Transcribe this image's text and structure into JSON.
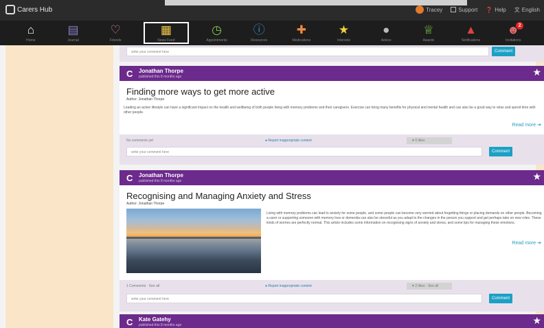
{
  "app": {
    "name": "Carers Hub"
  },
  "topbar": {
    "links": [
      {
        "label": "Tracey",
        "icon": "avatar-icon"
      },
      {
        "label": "Support",
        "icon": "monitor-icon"
      },
      {
        "label": "Help",
        "icon": "help-icon"
      },
      {
        "label": "English",
        "icon": "translate-icon"
      }
    ]
  },
  "nav": [
    {
      "label": "Home",
      "icon": "home-icon",
      "color": "#ffffff"
    },
    {
      "label": "Journal",
      "icon": "journal-icon",
      "color": "#8b7fc9"
    },
    {
      "label": "Friends",
      "icon": "handshake-icon",
      "color": "#e17b9a"
    },
    {
      "label": "News Feed",
      "icon": "newsfeed-icon",
      "color": "#f2c84b",
      "active": true
    },
    {
      "label": "Appointments",
      "icon": "clock-icon",
      "color": "#84c94b"
    },
    {
      "label": "Resources",
      "icon": "info-icon",
      "color": "#2c91d1"
    },
    {
      "label": "Medications",
      "icon": "medkit-icon",
      "color": "#ef8a3d"
    },
    {
      "label": "Interests",
      "icon": "star-icon",
      "color": "#f2d23c"
    },
    {
      "label": "Advice",
      "icon": "chat-icon",
      "color": "#bbbbbb"
    },
    {
      "label": "Awards",
      "icon": "trophy-icon",
      "color": "#7ccc4a"
    },
    {
      "label": "Notifications",
      "icon": "bell-icon",
      "color": "#e34040"
    },
    {
      "label": "Invitations",
      "icon": "invite-icon",
      "color": "#e36e6e",
      "badge": "2"
    }
  ],
  "comment_placeholder": "write your comment here",
  "comment_button": "Comment",
  "report_label": "Report inappropriate content",
  "posts": [
    {
      "author": "Jonathan Thorpe",
      "time": "published this 8 months ago",
      "title": "Finding more ways to get more active",
      "byline": "Author: Jonathan Thorpe",
      "summary": "Leading an active lifestyle can have a significant impact on the health and wellbeing of both people living with memory problems and their caregivers. Exercise can bring many benefits for physical and mental health and can also be a good way to relax and spend time with other people.",
      "read_more": "Read more",
      "comments_text": "No comments yet",
      "likes_text": "0 likes"
    },
    {
      "author": "Jonathan Thorpe",
      "time": "published this 8 months ago",
      "title": "Recognising and Managing Anxiety and Stress",
      "byline": "Author: Jonathan Thorpe",
      "summary": "Living with memory problems can lead to anxiety for some people, and some people can become very worried about forgetting things or placing demands on other people. Becoming a carer or supporting someone with memory loss or dementia can also be stressful as you adapt to the changes in the person you support and get perhaps take on new roles. These kinds of worries are perfectly normal. This article includes some information on recognising signs of anxiety and stress, and some tips for managing these emotions.",
      "read_more": "Read more",
      "comments_text": "1 Comments · See all",
      "likes_text": "2 likes · See all"
    },
    {
      "author": "Kate Gatehy",
      "time": "published this 8 months ago"
    }
  ]
}
